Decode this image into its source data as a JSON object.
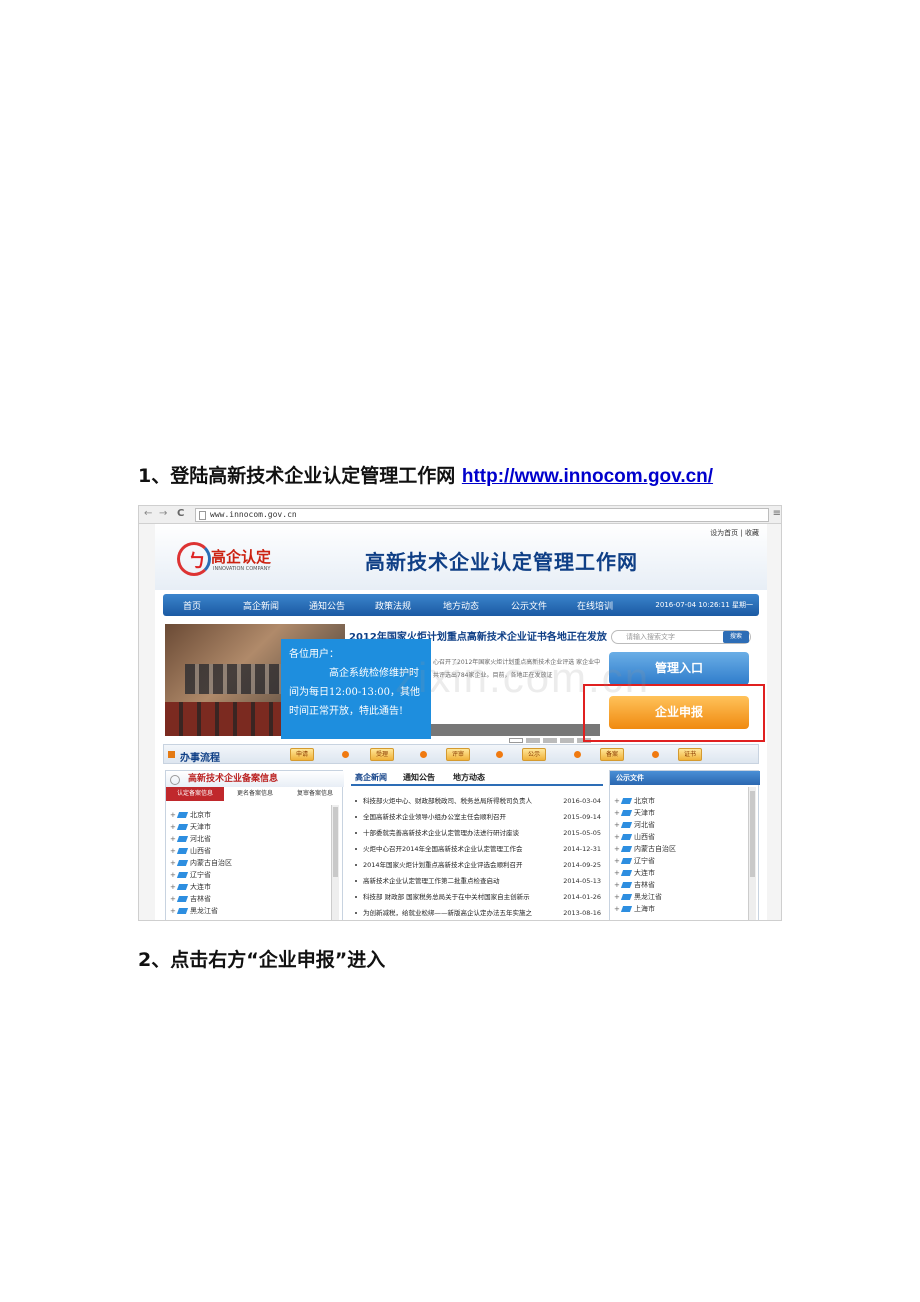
{
  "doc": {
    "step1_prefix": "1、登陆高新技术企业认定管理工作网 ",
    "step1_link": "http://www.innocom.gov.cn/",
    "step2": "2、点击右方“企业申报”进入"
  },
  "browser": {
    "back": "←",
    "forward": "→",
    "reload": "C",
    "url": "www.innocom.gov.cn",
    "menu": "≡"
  },
  "site": {
    "toplinks": "设为首页  |  收藏",
    "logo_glyph": "ㄅ",
    "logo_cn": "高企认定",
    "logo_en": "INNOVATION COMPANY",
    "title": "高新技术企业认定管理工作网",
    "nav": [
      "首页",
      "高企新闻",
      "通知公告",
      "政策法规",
      "地方动态",
      "公示文件",
      "在线培训"
    ],
    "datetime": "2016-07-04 10:26:11 星期一",
    "headline": "2012年国家火炬计划重点高新技术企业证书各地正在发放",
    "snippet": "心召开了2012年国家火炬计划重点高新技术企业评选 家企业中共评选出784家企业。目前，各地正在发放证",
    "notice": {
      "line1": "各位用户：",
      "line2": "高企系统检修维护时间为每日12:00-13:00，其他时间正常开放，特此通告!"
    },
    "search_placeholder": "请输入搜索文字",
    "search_button": "搜索",
    "manage_button": "管理入口",
    "enterprise_button": "企业申报",
    "process_title": "办事流程",
    "process_steps": [
      "申请",
      "受理",
      "评审",
      "公示",
      "备案",
      "证书"
    ],
    "left_panel": {
      "title": "高新技术企业备案信息",
      "tabs": [
        "认定备案信息",
        "更名备案信息",
        "复审备案信息"
      ],
      "regions": [
        "北京市",
        "天津市",
        "河北省",
        "山西省",
        "内蒙古自治区",
        "辽宁省",
        "大连市",
        "吉林省",
        "黑龙江省"
      ]
    },
    "mid_panel": {
      "tabs": [
        "高企新闻",
        "通知公告",
        "地方动态"
      ],
      "news": [
        {
          "title": "科技部火炬中心、财政部税政司、税务总局所得税司负责人",
          "date": "2016-03-04"
        },
        {
          "title": "全国高新技术企业领导小组办公室主任会顺利召开",
          "date": "2015-09-14"
        },
        {
          "title": "十部委就完善高新技术企业认定管理办法进行研讨座谈",
          "date": "2015-05-05"
        },
        {
          "title": "火炬中心召开2014年全国高新技术企业认定管理工作会",
          "date": "2014-12-31"
        },
        {
          "title": "2014年国家火炬计划重点高新技术企业评选会顺利召开",
          "date": "2014-09-25"
        },
        {
          "title": "高新技术企业认定管理工作第二批重点检查启动",
          "date": "2014-05-13"
        },
        {
          "title": "科技部 财政部 国家税务总局关于在中关村国家自主创新示",
          "date": "2014-01-26"
        },
        {
          "title": "为创新减税，给就业松绑——新版高企认定办法五年实施之",
          "date": "2013-08-16"
        }
      ]
    },
    "right_panel": {
      "title": "公示文件",
      "regions": [
        "北京市",
        "天津市",
        "河北省",
        "山西省",
        "内蒙古自治区",
        "辽宁省",
        "大连市",
        "吉林省",
        "黑龙江省",
        "上海市"
      ]
    },
    "watermark": "zixin.com.cn"
  },
  "colors": {
    "nav_blue": "#1b5aa3",
    "title_blue": "#0f3f86",
    "notice_blue": "#1e8ede",
    "enterprise_orange": "#f08a10",
    "highlight_red": "#e02020"
  }
}
